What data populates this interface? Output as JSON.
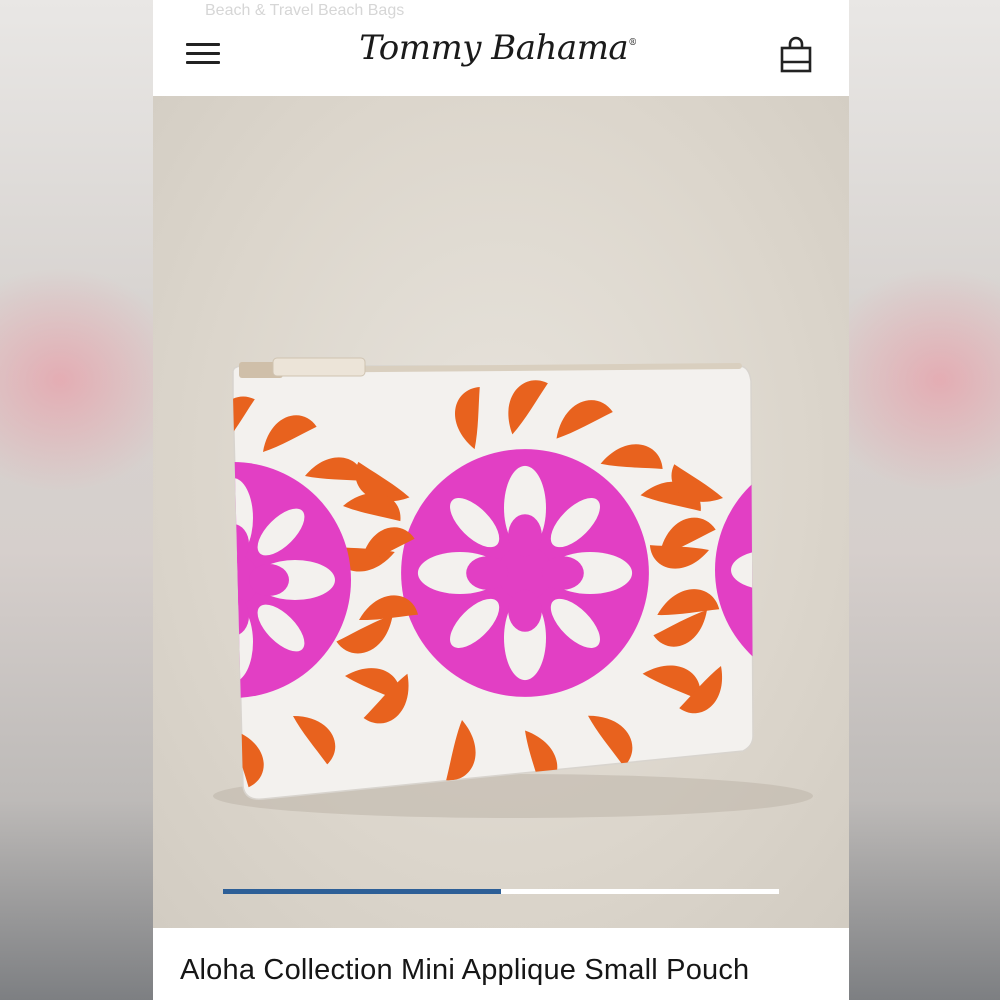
{
  "header": {
    "breadcrumb_peek": "Beach & Travel  Beach Bags",
    "brand": "Tommy Bahama",
    "brand_mark": "®",
    "menu_icon": "hamburger-menu-icon",
    "bag_icon": "shopping-bag-icon"
  },
  "gallery": {
    "progress": 0.5,
    "progress_color": "#2d5f97",
    "image_alt": "Aloha Collection Mini Applique Small Pouch product photo"
  },
  "product": {
    "title": "Aloha Collection Mini Applique Small Pouch"
  },
  "colors": {
    "pouch_pink": "#e23fc4",
    "pouch_orange": "#e8621e",
    "pouch_white": "#f3f1ee"
  }
}
